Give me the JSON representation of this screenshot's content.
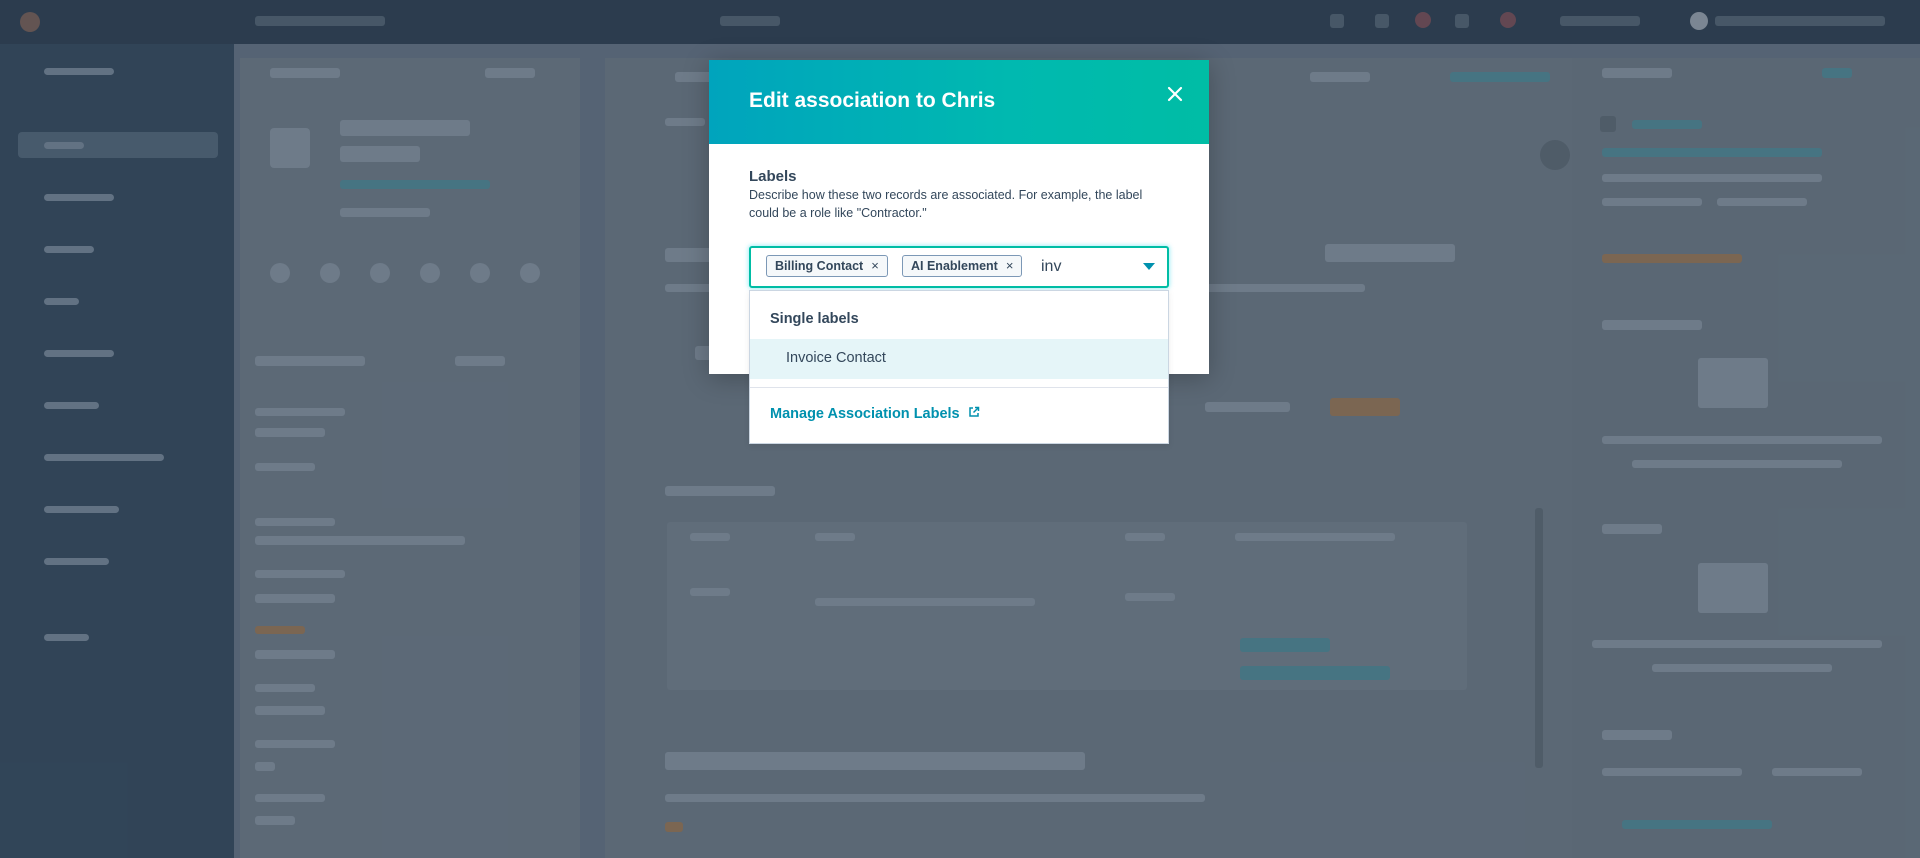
{
  "modal": {
    "title": "Edit association to Chris",
    "close_icon": "close-icon",
    "labels_title": "Labels",
    "labels_description": "Describe how these two records are associated. For example, the label could be a role like \"Contractor.\""
  },
  "tag_input": {
    "chips": [
      {
        "label": "Billing Contact",
        "remove": "×"
      },
      {
        "label": "AI Enablement",
        "remove": "×"
      }
    ],
    "typed_value": "inv",
    "dropdown_icon": "caret-down-icon"
  },
  "dropdown": {
    "group_title": "Single labels",
    "options": [
      "Invoice Contact"
    ],
    "manage_link": "Manage Association Labels",
    "manage_icon": "external-link-icon"
  },
  "colors": {
    "header_gradient_start": "#00a4bd",
    "header_gradient_end": "#00bda5",
    "link": "#0091ae",
    "text": "#33475b",
    "highlight": "#e5f5f8"
  }
}
